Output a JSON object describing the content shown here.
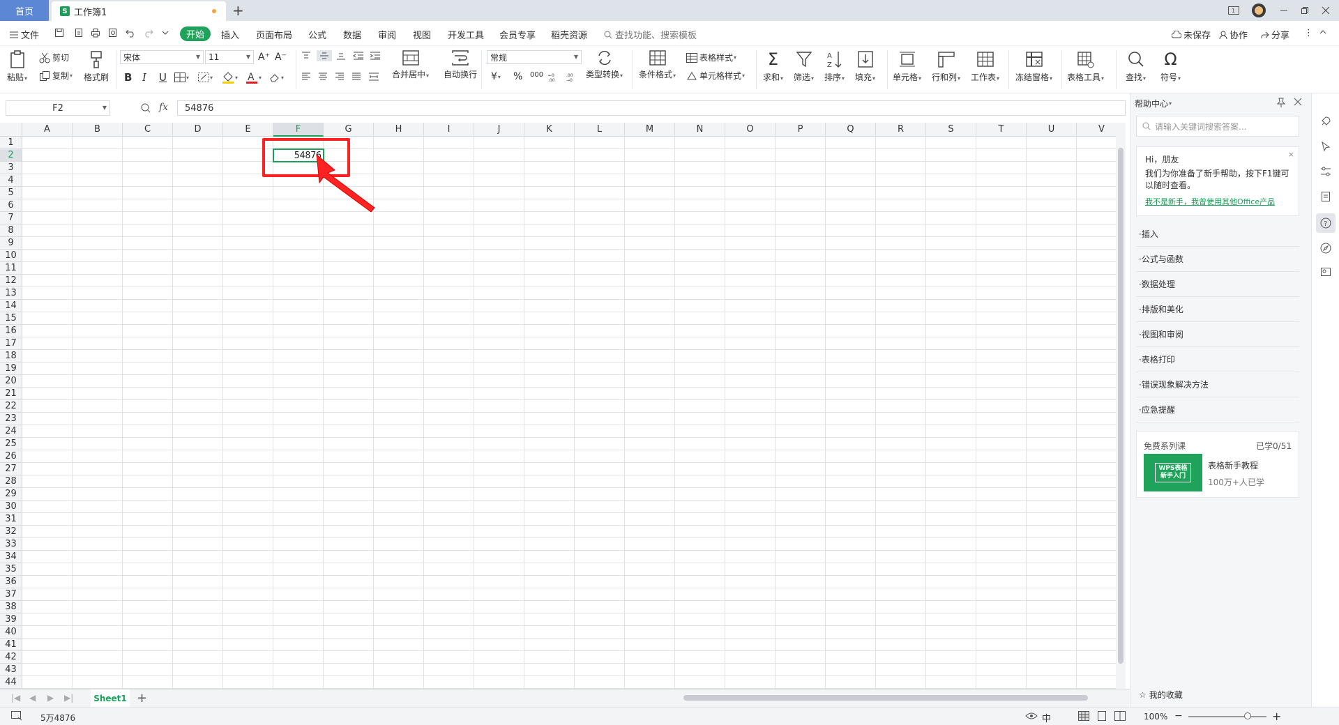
{
  "tabs": {
    "home": "首页",
    "document": "工作簿1",
    "doc_icon": "S"
  },
  "menu": {
    "file": "文件",
    "items": [
      "开始",
      "插入",
      "页面布局",
      "公式",
      "数据",
      "审阅",
      "视图",
      "开发工具",
      "会员专享",
      "稻壳资源"
    ],
    "search_placeholder": "查找功能、搜索模板",
    "unsaved": "未保存",
    "collaborate": "协作",
    "share": "分享"
  },
  "ribbon": {
    "paste": "粘贴",
    "cut": "剪切",
    "copy": "复制",
    "format_painter": "格式刷",
    "font_name": "宋体",
    "font_size": "11",
    "merge_center": "合并居中",
    "auto_wrap": "自动换行",
    "number_format": "常规",
    "type_convert": "类型转换",
    "conditional_format": "条件格式",
    "table_style": "表格样式",
    "cell_style": "单元格样式",
    "sum": "求和",
    "filter": "筛选",
    "sort": "排序",
    "fill": "填充",
    "cell": "单元格",
    "row_col": "行和列",
    "worksheet": "工作表",
    "freeze": "冻结窗格",
    "table_tools": "表格工具",
    "find": "查找",
    "symbol": "符号",
    "bold": "B",
    "italic": "I",
    "underline": "U",
    "currency": "¥",
    "percent": "%",
    "thousands": "000"
  },
  "formula_bar": {
    "cell_ref": "F2",
    "fx": "fx",
    "value": "54876"
  },
  "grid": {
    "columns": [
      "A",
      "B",
      "C",
      "D",
      "E",
      "F",
      "G",
      "H",
      "I",
      "J",
      "K",
      "L",
      "M",
      "N",
      "O",
      "P",
      "Q",
      "R",
      "S",
      "T",
      "U",
      "V"
    ],
    "selected_column": "F",
    "selected_row": 2,
    "rows": 44,
    "active_cell_value": "54876"
  },
  "sheets": {
    "active": "Sheet1"
  },
  "status": {
    "cell_display": "5万4876",
    "zoom": "100%",
    "ime": "中"
  },
  "help_panel": {
    "title": "帮助中心",
    "search_placeholder": "请输入关键词搜索答案...",
    "greeting": "Hi，朋友",
    "intro": "我们为你准备了新手帮助，按下F1键可以随时查看。",
    "link": "我不是新手，我曾使用其他Office产品",
    "items": [
      "插入",
      "公式与函数",
      "数据处理",
      "排版和美化",
      "视图和审阅",
      "表格打印",
      "错误现象解决方法",
      "应急提醒"
    ],
    "course_header": "免费系列课",
    "course_progress": "已学0/51",
    "course_thumb": "WPS表格\n新手入门",
    "course_title": "表格新手教程",
    "course_learners": "100万+人已学",
    "favorites": "我的收藏"
  },
  "colors": {
    "accent": "#1a9f58",
    "highlight": "#ff2222",
    "home_tab": "#5b87d4"
  }
}
